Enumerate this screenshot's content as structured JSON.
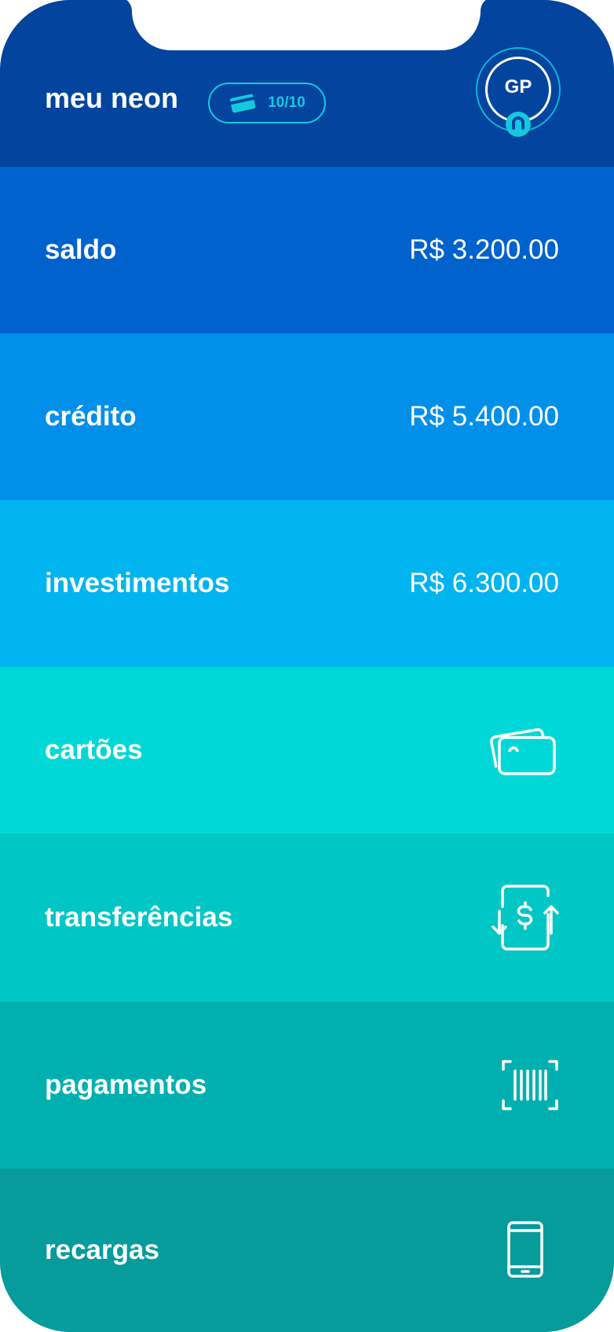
{
  "header": {
    "title": "meu neon",
    "badge": {
      "icon": "card-icon",
      "text": "10/10"
    },
    "avatar": {
      "initials": "GP",
      "badge_icon": "neon-logo-icon"
    }
  },
  "rows": [
    {
      "label": "saldo",
      "value": "R$ 3.200.00",
      "color": "#0062CC"
    },
    {
      "label": "crédito",
      "value": "R$ 5.400.00",
      "color": "#0090EA"
    },
    {
      "label": "investimentos",
      "value": "R$ 6.300.00",
      "color": "#00B4F0"
    },
    {
      "label": "cartões",
      "icon": "cards-icon",
      "color": "#00D8D8"
    },
    {
      "label": "transferências",
      "icon": "transfer-icon",
      "color": "#00C6C6"
    },
    {
      "label": "pagamentos",
      "icon": "barcode-icon",
      "color": "#00B0B0"
    },
    {
      "label": "recargas",
      "icon": "phone-icon",
      "color": "#069C9C"
    }
  ],
  "colors": {
    "header": "#03459E",
    "accent": "#13C9E0"
  }
}
